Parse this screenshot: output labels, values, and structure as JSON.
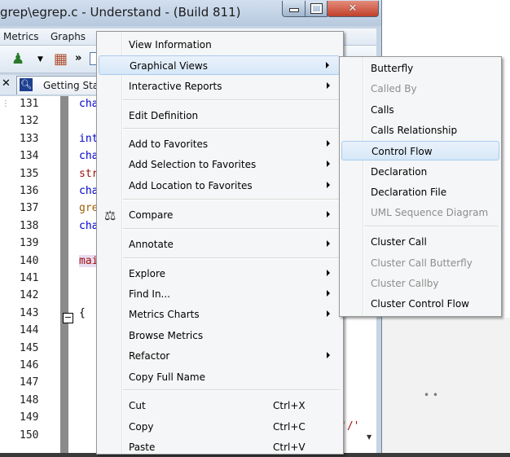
{
  "window": {
    "title": "grep\\egrep.c - Understand - (Build 811)"
  },
  "menubar": {
    "items": [
      "Metrics",
      "Graphs"
    ]
  },
  "toolbar": {
    "more_label": "»"
  },
  "tabs": [
    {
      "label": "Getting Star"
    }
  ],
  "editor": {
    "lines": [
      {
        "no": "131",
        "code": "cha",
        "color": "#0000cc"
      },
      {
        "no": "132",
        "code": "",
        "color": "#000000"
      },
      {
        "no": "133",
        "code": "int",
        "color": "#0000cc"
      },
      {
        "no": "134",
        "code": "cha",
        "color": "#0000cc"
      },
      {
        "no": "135",
        "code": "str",
        "color": "#a01010"
      },
      {
        "no": "136",
        "code": "cha",
        "color": "#0000cc"
      },
      {
        "no": "137",
        "code": "gre",
        "color": "#a06000"
      },
      {
        "no": "138",
        "code": "cha",
        "color": "#0000cc"
      },
      {
        "no": "139",
        "code": "",
        "color": "#000000"
      },
      {
        "no": "140",
        "code": "mai",
        "color": "#a01010"
      },
      {
        "no": "141",
        "code": "",
        "color": "#000000"
      },
      {
        "no": "142",
        "code": "",
        "color": "#000000"
      },
      {
        "no": "143",
        "code": "{",
        "color": "#000000"
      },
      {
        "no": "144",
        "code": "",
        "color": "#000000"
      },
      {
        "no": "145",
        "code": "",
        "color": "#000000"
      },
      {
        "no": "146",
        "code": "",
        "color": "#000000"
      },
      {
        "no": "147",
        "code": "",
        "color": "#000000"
      },
      {
        "no": "148",
        "code": "",
        "color": "#000000"
      },
      {
        "no": "149",
        "code": "",
        "color": "#000000"
      },
      {
        "no": "150",
        "code": "",
        "color": "#000000"
      }
    ],
    "tail": "'/'"
  },
  "context_menu": {
    "items": [
      {
        "label": "View Information",
        "submenu": false
      },
      {
        "label": "Graphical Views",
        "submenu": true
      },
      {
        "label": "Interactive Reports",
        "submenu": true
      },
      {
        "label": "Edit Definition",
        "submenu": false
      },
      {
        "label": "Add to Favorites",
        "submenu": true
      },
      {
        "label": "Add Selection to Favorites",
        "submenu": true
      },
      {
        "label": "Add Location to Favorites",
        "submenu": true
      },
      {
        "label": "Compare",
        "submenu": true
      },
      {
        "label": "Annotate",
        "submenu": true
      },
      {
        "label": "Explore",
        "submenu": true
      },
      {
        "label": "Find In...",
        "submenu": true
      },
      {
        "label": "Metrics Charts",
        "submenu": true
      },
      {
        "label": "Browse Metrics",
        "submenu": false
      },
      {
        "label": "Refactor",
        "submenu": true
      },
      {
        "label": "Copy Full Name",
        "submenu": false
      },
      {
        "label": "Cut",
        "shortcut": "Ctrl+X",
        "submenu": false
      },
      {
        "label": "Copy",
        "shortcut": "Ctrl+C",
        "submenu": false
      },
      {
        "label": "Paste",
        "shortcut": "Ctrl+V",
        "submenu": false
      }
    ]
  },
  "submenu": {
    "items": [
      {
        "label": "Butterfly",
        "enabled": true
      },
      {
        "label": "Called By",
        "enabled": false
      },
      {
        "label": "Calls",
        "enabled": true
      },
      {
        "label": "Calls Relationship",
        "enabled": true
      },
      {
        "label": "Control Flow",
        "enabled": true
      },
      {
        "label": "Declaration",
        "enabled": true
      },
      {
        "label": "Declaration File",
        "enabled": true
      },
      {
        "label": "UML Sequence Diagram",
        "enabled": false
      },
      {
        "label": "Cluster Call",
        "enabled": true
      },
      {
        "label": "Cluster Call Butterfly",
        "enabled": false
      },
      {
        "label": "Cluster Callby",
        "enabled": false
      },
      {
        "label": "Cluster Control Flow",
        "enabled": true
      }
    ]
  },
  "colors": {
    "highlight": "#d6e7f8",
    "disabled_text": "#8d8d8d"
  }
}
